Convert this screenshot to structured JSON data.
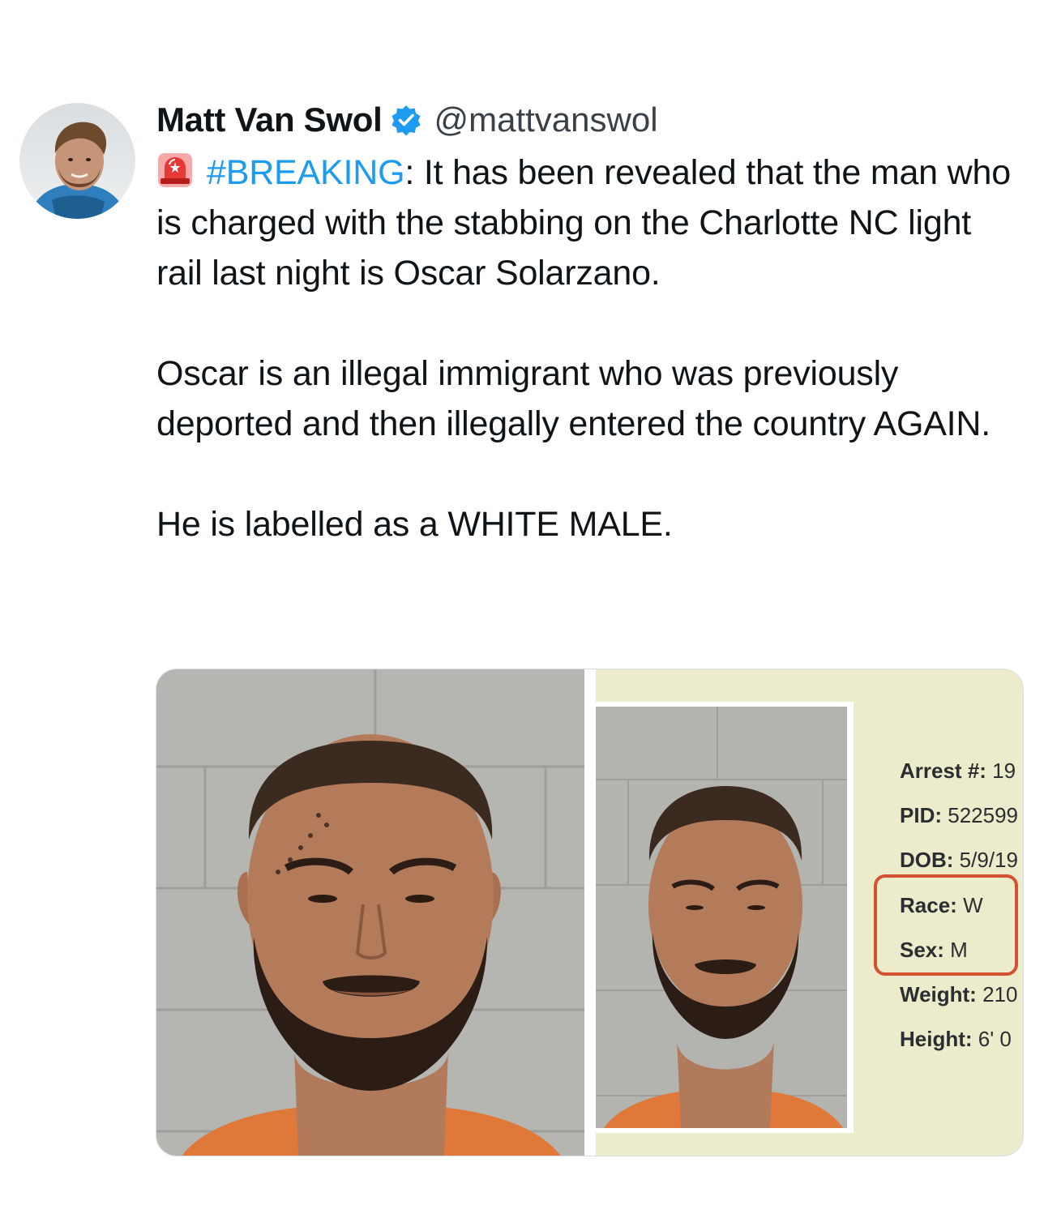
{
  "author": {
    "display_name": "Matt Van Swol",
    "handle": "@mattvanswol",
    "verified_icon": "verified-badge-icon",
    "avatar_icon": "avatar"
  },
  "tweet": {
    "emoji": "police-siren-icon",
    "hashtag": "#BREAKING",
    "line1_rest": ": It has been revealed that the man who is charged with the stabbing on the Charlotte NC light rail last night is Oscar Solarzano.",
    "paragraph2": "Oscar is an illegal immigrant who was previously deported and then illegally entered the country AGAIN.",
    "paragraph3": "He is labelled as a WHITE MALE."
  },
  "record": {
    "arrest_label": "Arrest #:",
    "arrest_value": "19",
    "pid_label": "PID:",
    "pid_value": "522599",
    "dob_label": "DOB:",
    "dob_value": "5/9/19",
    "race_label": "Race:",
    "race_value": "W",
    "sex_label": "Sex:",
    "sex_value": "M",
    "weight_label": "Weight:",
    "weight_value": "210",
    "height_label": "Height:",
    "height_value": "6' 0"
  },
  "colors": {
    "hashtag": "#1d9bf0",
    "verified": "#1d9bf0",
    "highlight": "#d4502f",
    "record_bg": "#ecebcc"
  }
}
